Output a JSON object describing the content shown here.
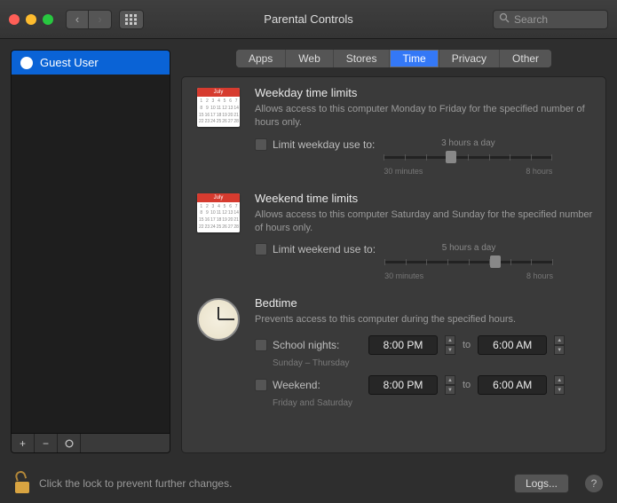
{
  "window": {
    "title": "Parental Controls",
    "search_placeholder": "Search"
  },
  "sidebar": {
    "users": [
      {
        "name": "Guest User"
      }
    ],
    "add": "+",
    "remove": "−",
    "gear": "✽"
  },
  "tabs": [
    "Apps",
    "Web",
    "Stores",
    "Time",
    "Privacy",
    "Other"
  ],
  "active_tab": "Time",
  "weekday": {
    "title": "Weekday time limits",
    "desc": "Allows access to this computer Monday to Friday for the specified number of hours only.",
    "checkbox": "Limit weekday use to:",
    "value": "3 hours a day",
    "min": "30 minutes",
    "max": "8 hours",
    "thumb_pct": 40
  },
  "weekend": {
    "title": "Weekend time limits",
    "desc": "Allows access to this computer Saturday and Sunday for the specified number of hours only.",
    "checkbox": "Limit weekend use to:",
    "value": "5 hours a day",
    "min": "30 minutes",
    "max": "8 hours",
    "thumb_pct": 66
  },
  "bedtime": {
    "title": "Bedtime",
    "desc": "Prevents access to this computer during the specified hours.",
    "school_label": "School nights:",
    "school_note": "Sunday – Thursday",
    "school_from": "8:00 PM",
    "school_to": "6:00 AM",
    "weekend_label": "Weekend:",
    "weekend_note": "Friday and Saturday",
    "weekend_from": "8:00 PM",
    "weekend_to": "6:00 AM",
    "to": "to"
  },
  "footer": {
    "lock_text": "Click the lock to prevent further changes.",
    "logs": "Logs...",
    "help": "?"
  },
  "cal_month": "July"
}
